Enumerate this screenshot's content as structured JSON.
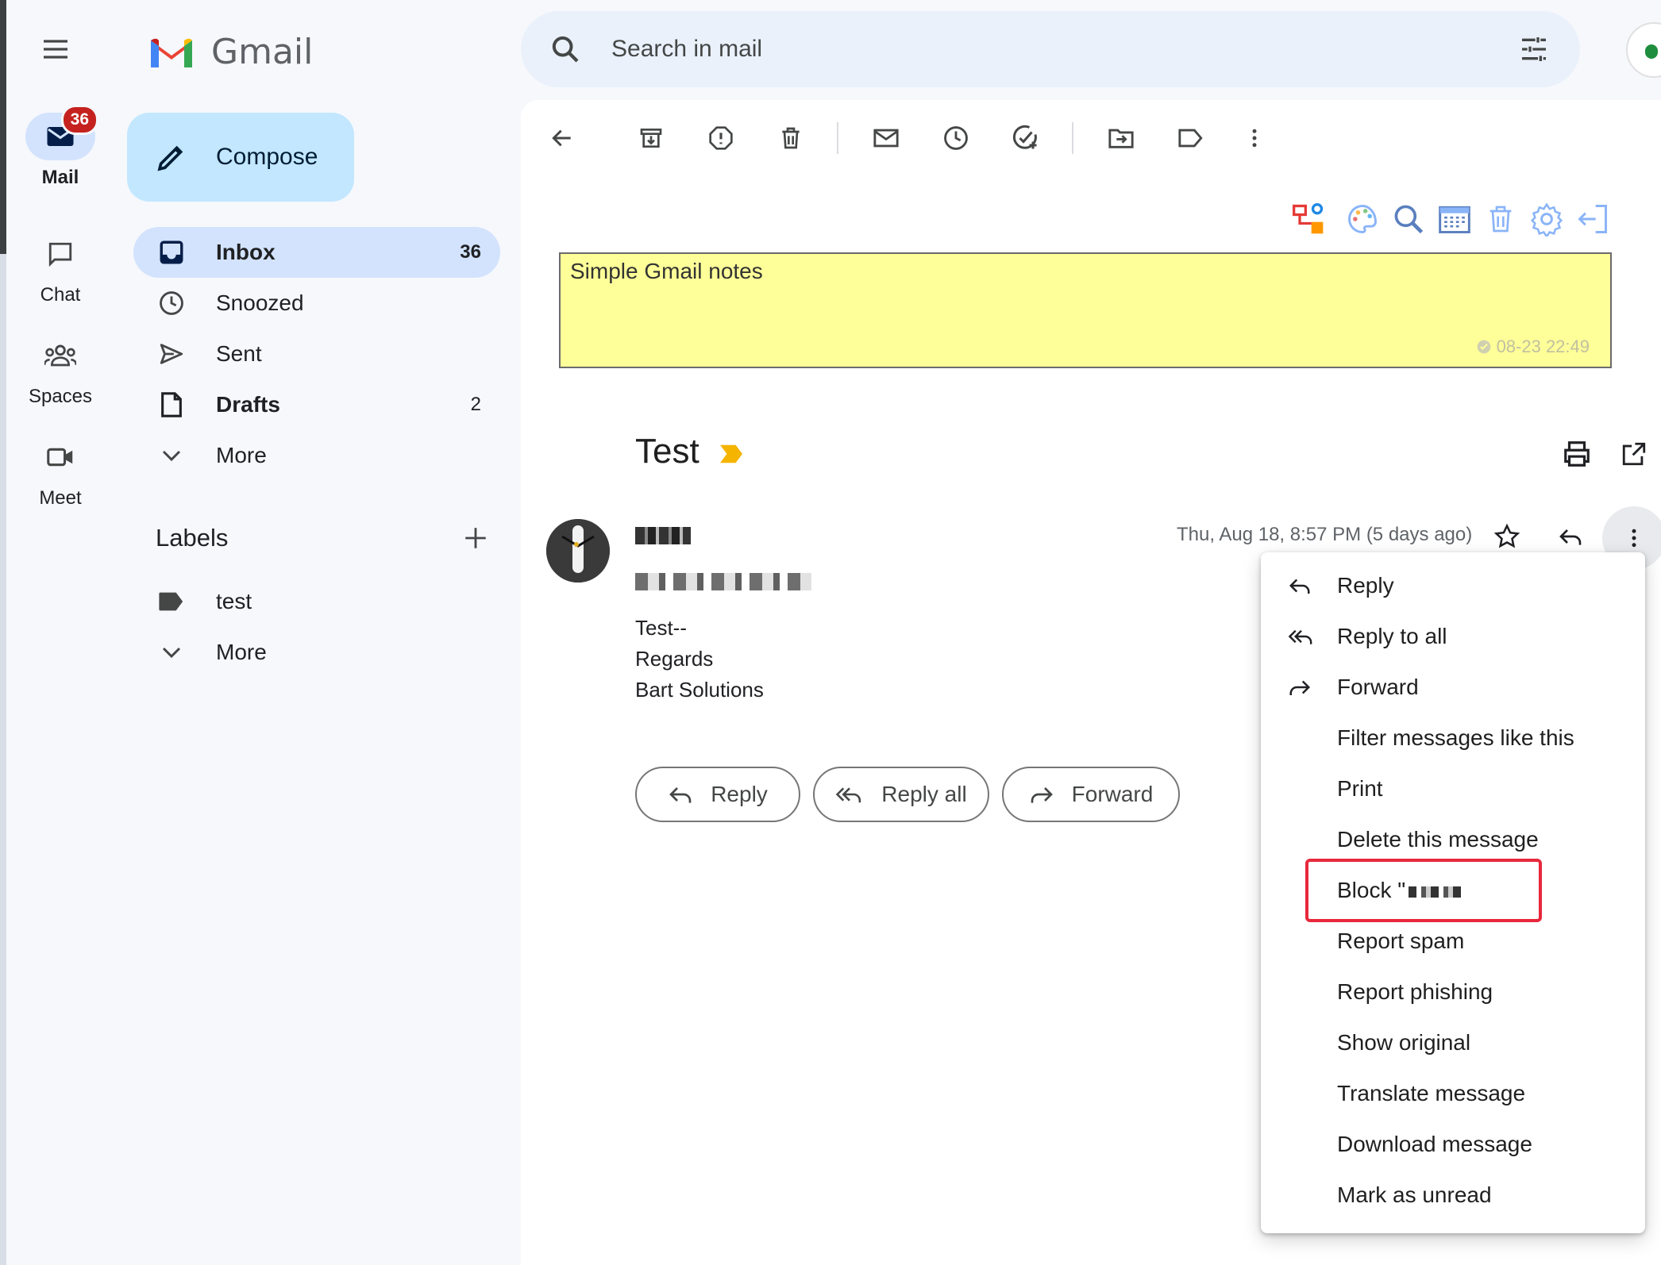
{
  "app": {
    "name": "Gmail"
  },
  "rail": {
    "items": [
      {
        "label": "Mail",
        "badge": "36"
      },
      {
        "label": "Chat"
      },
      {
        "label": "Spaces"
      },
      {
        "label": "Meet"
      }
    ]
  },
  "compose": {
    "label": "Compose"
  },
  "nav": {
    "items": [
      {
        "label": "Inbox",
        "count": "36"
      },
      {
        "label": "Snoozed",
        "count": ""
      },
      {
        "label": "Sent",
        "count": ""
      },
      {
        "label": "Drafts",
        "count": "2"
      },
      {
        "label": "More",
        "count": ""
      }
    ]
  },
  "labels": {
    "title": "Labels",
    "items": [
      {
        "label": "test"
      },
      {
        "label": "More"
      }
    ]
  },
  "search": {
    "placeholder": "Search in mail"
  },
  "notes": {
    "title": "Simple Gmail notes",
    "timestamp": "08-23 22:49",
    "bg_color": "#ffff99"
  },
  "email": {
    "subject": "Test",
    "date": "Thu, Aug 18, 8:57 PM (5 days ago)",
    "body": [
      "Test--",
      "Regards",
      "Bart Solutions"
    ]
  },
  "actions": {
    "reply": "Reply",
    "reply_all": "Reply all",
    "forward": "Forward"
  },
  "menu": {
    "items": [
      {
        "label": "Reply",
        "icon": "reply-icon"
      },
      {
        "label": "Reply to all",
        "icon": "reply-all-icon"
      },
      {
        "label": "Forward",
        "icon": "forward-icon"
      },
      {
        "label": "Filter messages like this"
      },
      {
        "label": "Print"
      },
      {
        "label": "Delete this message"
      },
      {
        "label": "Block \""
      },
      {
        "label": "Report spam"
      },
      {
        "label": "Report phishing"
      },
      {
        "label": "Show original"
      },
      {
        "label": "Translate message"
      },
      {
        "label": "Download message"
      },
      {
        "label": "Mark as unread"
      }
    ],
    "highlight_color": "#e8283c"
  },
  "colors": {
    "accent": "#c2e7ff",
    "active_nav": "#d3e3fd",
    "badge": "#c5221f",
    "important": "#f4b400"
  }
}
